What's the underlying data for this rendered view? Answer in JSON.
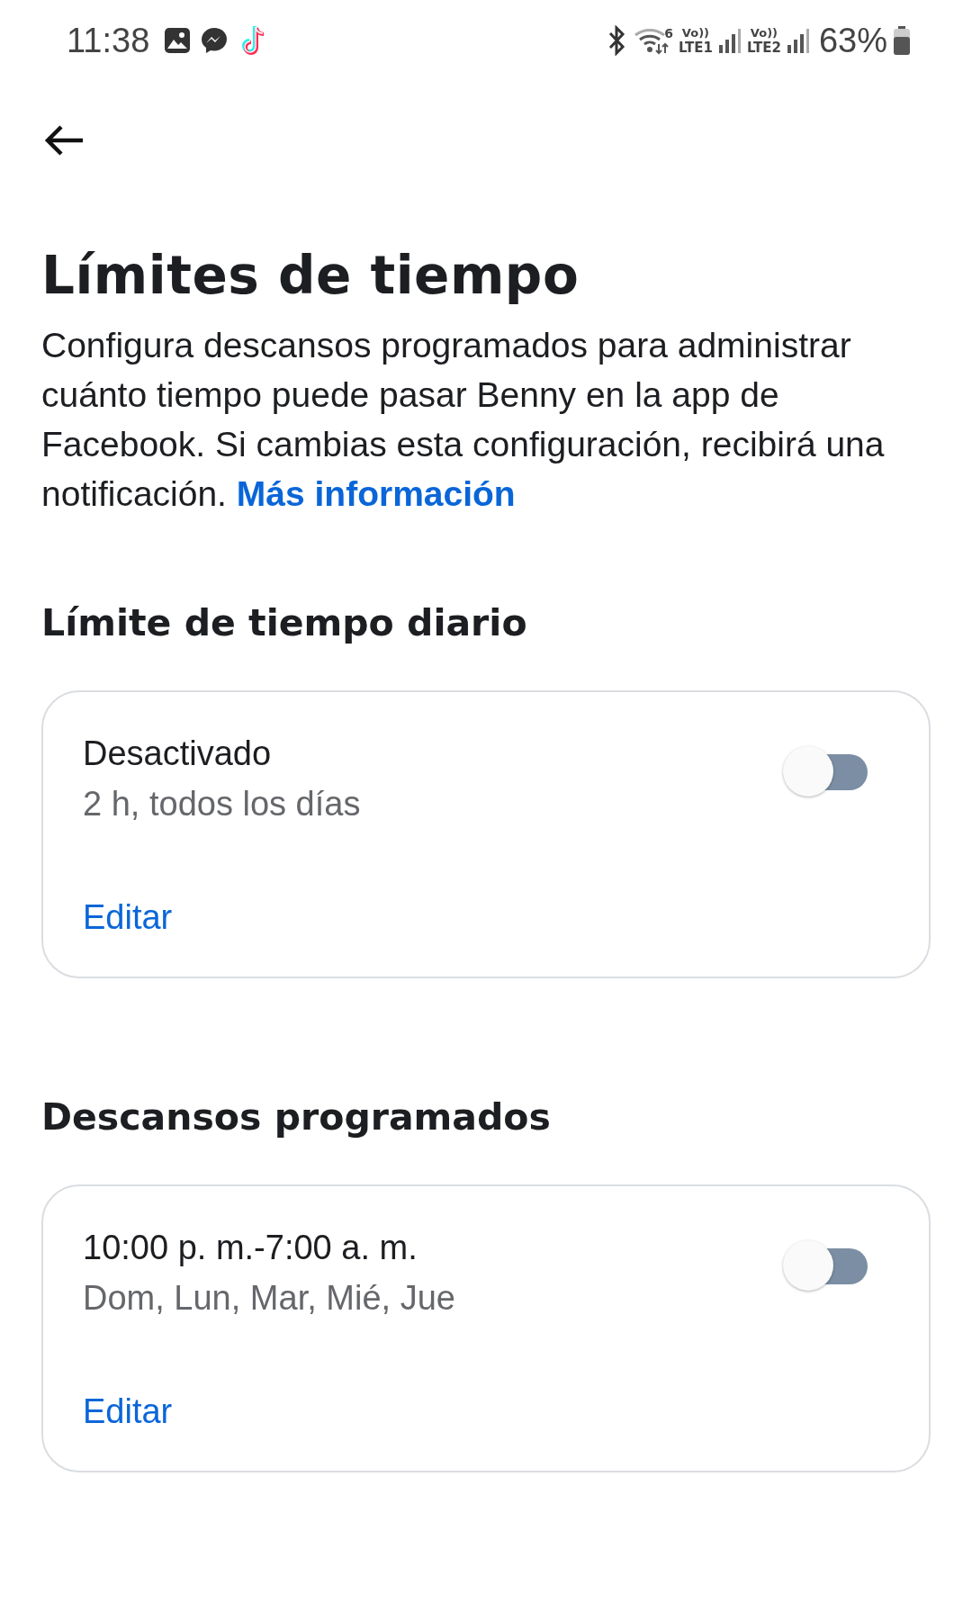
{
  "status_bar": {
    "time": "11:38",
    "wifi_label": "6",
    "sim1": {
      "top": "Vo))",
      "bottom": "LTE1"
    },
    "sim2": {
      "top": "Vo))",
      "bottom": "LTE2"
    },
    "battery": "63%"
  },
  "title": "Límites de tiempo",
  "description": "Configura descansos programados para administrar cuánto tiempo puede pasar Benny en la app de Facebook. Si cambias esta configuración, recibirá una notificación.",
  "learn_more": "Más información",
  "sections": [
    {
      "heading": "Límite de tiempo diario",
      "card": {
        "title": "Desactivado",
        "subtitle": "2 h, todos los días",
        "on": false,
        "action": "Editar"
      }
    },
    {
      "heading": "Descansos programados",
      "card": {
        "title": "10:00 p. m.-7:00 a. m.",
        "subtitle": "Dom, Lun, Mar, Mié, Jue",
        "on": false,
        "action": "Editar"
      }
    }
  ]
}
